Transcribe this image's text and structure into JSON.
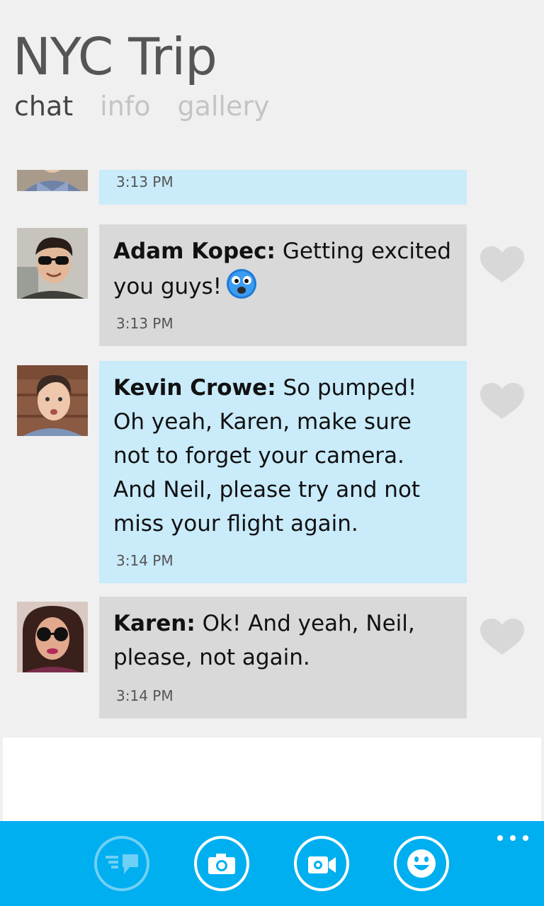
{
  "header": {
    "title": "NYC Trip",
    "tabs": [
      {
        "label": "chat",
        "active": true
      },
      {
        "label": "info",
        "active": false
      },
      {
        "label": "gallery",
        "active": false
      }
    ]
  },
  "messages": [
    {
      "sender": "",
      "text": "",
      "time": "3:13 PM",
      "bubble_color": "#c9ebfa",
      "partial": true
    },
    {
      "sender": "Adam Kopec:",
      "text": "Getting excited you guys!",
      "emoji": "surprised-face-emoji",
      "time": "3:13 PM",
      "bubble_color": "#d9d9d9"
    },
    {
      "sender": "Kevin Crowe:",
      "text": "So pumped! Oh yeah, Karen, make sure not to forget your camera. And Neil, please try and not miss your flight again.",
      "time": "3:14 PM",
      "bubble_color": "#c9ebfa"
    },
    {
      "sender": "Karen:",
      "text": "Ok! And yeah, Neil, please, not again.",
      "time": "3:14 PM",
      "bubble_color": "#d9d9d9"
    }
  ],
  "composer": {
    "value": "",
    "placeholder": ""
  },
  "app_bar": {
    "color": "#00aff0",
    "buttons": [
      {
        "icon": "send-message-icon",
        "enabled": false
      },
      {
        "icon": "camera-icon",
        "enabled": true
      },
      {
        "icon": "video-call-icon",
        "enabled": true
      },
      {
        "icon": "emoticon-icon",
        "enabled": true
      }
    ],
    "more_icon": "ellipsis-icon"
  }
}
